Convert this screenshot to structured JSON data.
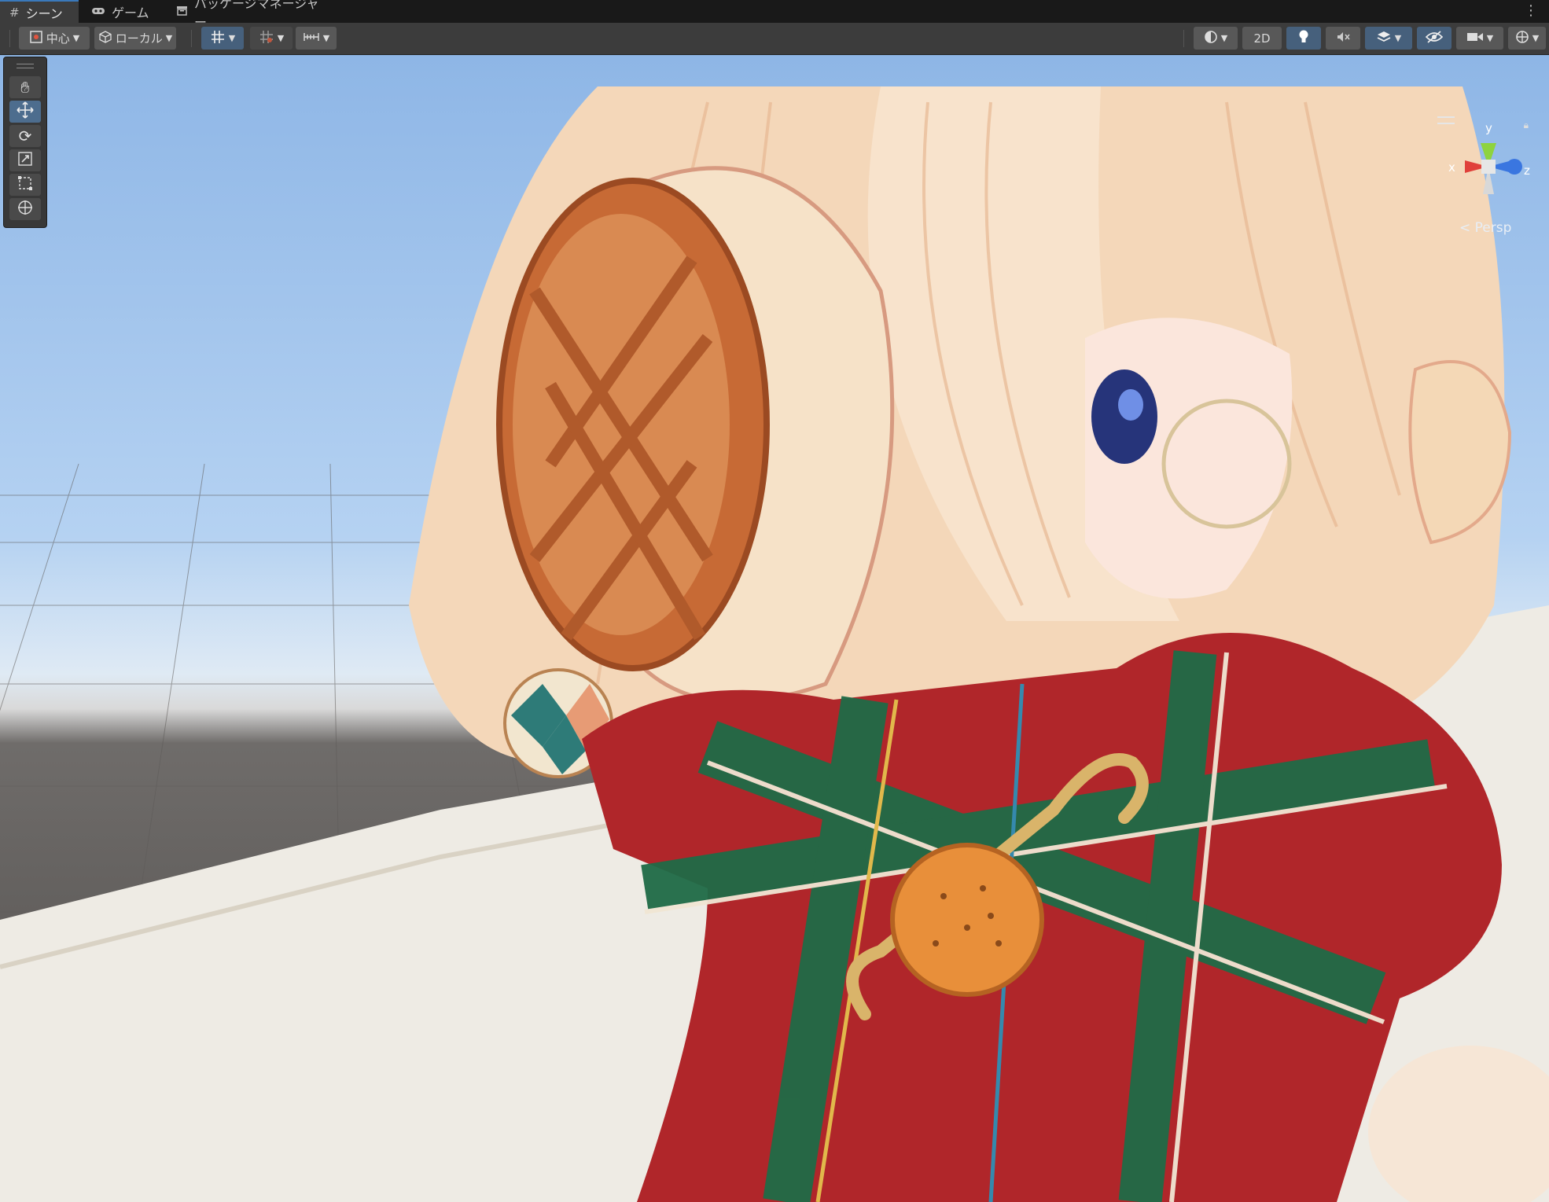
{
  "tabs": [
    {
      "label": "シーン",
      "icon": "grid-icon",
      "active": true
    },
    {
      "label": "ゲーム",
      "icon": "gamepad-icon",
      "active": false
    },
    {
      "label": "パッケージマネージャー",
      "icon": "package-icon",
      "active": false
    }
  ],
  "toolbar": {
    "pivot_mode": "中心",
    "pivot_rotation": "ローカル",
    "mode_2d": "2D"
  },
  "gizmo": {
    "y": "y",
    "x": "x",
    "z": "z",
    "projection": "Persp"
  },
  "colors": {
    "accent": "#3a79bb",
    "active_button": "#46607c",
    "toolbar_bg": "#3c3c3c",
    "gizmo_x": "#e0403a",
    "gizmo_y": "#8ed33e",
    "gizmo_z": "#3a76e0"
  }
}
